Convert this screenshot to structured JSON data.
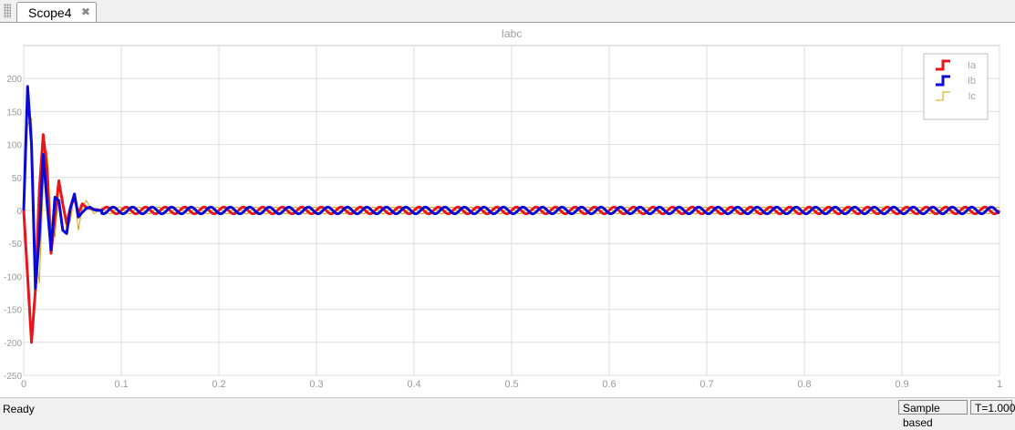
{
  "tab": {
    "title": "Scope4",
    "close_glyph": "✖"
  },
  "status": {
    "ready": "Ready",
    "mode": "Sample based",
    "time": "T=1.000"
  },
  "chart_data": {
    "type": "line",
    "title": "Iabc",
    "xlabel": "",
    "ylabel": "",
    "xlim": [
      0,
      1
    ],
    "ylim": [
      -250,
      250
    ],
    "xticks": [
      0,
      0.1,
      0.2,
      0.3,
      0.4,
      0.5,
      0.6,
      0.7,
      0.8,
      0.9,
      1
    ],
    "xtick_labels": [
      "0",
      "0.1",
      "0.2",
      "0.3",
      "0.4",
      "0.5",
      "0.6",
      "0.7",
      "0.8",
      "0.9",
      "1"
    ],
    "yticks": [
      -250,
      -200,
      -150,
      -100,
      -50,
      0,
      50,
      100,
      150,
      200
    ],
    "ytick_labels": [
      "-250",
      "-200",
      "-150",
      "-100",
      "-50",
      "0",
      "50",
      "100",
      "150",
      "200"
    ],
    "grid": true,
    "legend_position": "top-right",
    "series": [
      {
        "name": "Ia",
        "color": "#e8161b",
        "width": 3,
        "x": [
          0,
          0.004,
          0.008,
          0.012,
          0.016,
          0.02,
          0.024,
          0.028,
          0.032,
          0.036,
          0.04,
          0.044,
          0.048,
          0.052,
          0.056,
          0.06,
          0.064,
          0.068,
          0.072,
          0.076,
          0.08
        ],
        "y": [
          0,
          -100,
          -200,
          -120,
          30,
          115,
          60,
          -65,
          -10,
          45,
          10,
          -20,
          5,
          20,
          -5,
          10,
          5,
          3,
          2,
          1,
          0
        ]
      },
      {
        "name": "Ib",
        "color": "#0a0ad6",
        "width": 3,
        "x": [
          0,
          0.004,
          0.008,
          0.012,
          0.016,
          0.02,
          0.024,
          0.028,
          0.032,
          0.036,
          0.04,
          0.044,
          0.048,
          0.052,
          0.056,
          0.06,
          0.064,
          0.068,
          0.072,
          0.076,
          0.08
        ],
        "y": [
          0,
          188,
          100,
          -118,
          -40,
          85,
          10,
          -60,
          20,
          15,
          -30,
          -35,
          5,
          25,
          -10,
          -3,
          3,
          5,
          1,
          0,
          0
        ]
      },
      {
        "name": "Ic",
        "color": "#e0a100",
        "width": 1,
        "x": [
          0,
          0.004,
          0.008,
          0.012,
          0.016,
          0.02,
          0.024,
          0.028,
          0.032,
          0.036,
          0.04,
          0.044,
          0.048,
          0.052,
          0.056,
          0.06,
          0.064,
          0.068,
          0.072,
          0.076,
          0.08
        ],
        "y": [
          0,
          130,
          140,
          -60,
          -110,
          40,
          90,
          -20,
          -40,
          30,
          20,
          -30,
          -15,
          25,
          -30,
          5,
          15,
          5,
          -5,
          0,
          0
        ]
      }
    ],
    "steady_state": {
      "amplitude": 5,
      "frequency_hz": 50,
      "start": 0.08,
      "phase_deg": [
        0,
        -120,
        120
      ]
    }
  }
}
